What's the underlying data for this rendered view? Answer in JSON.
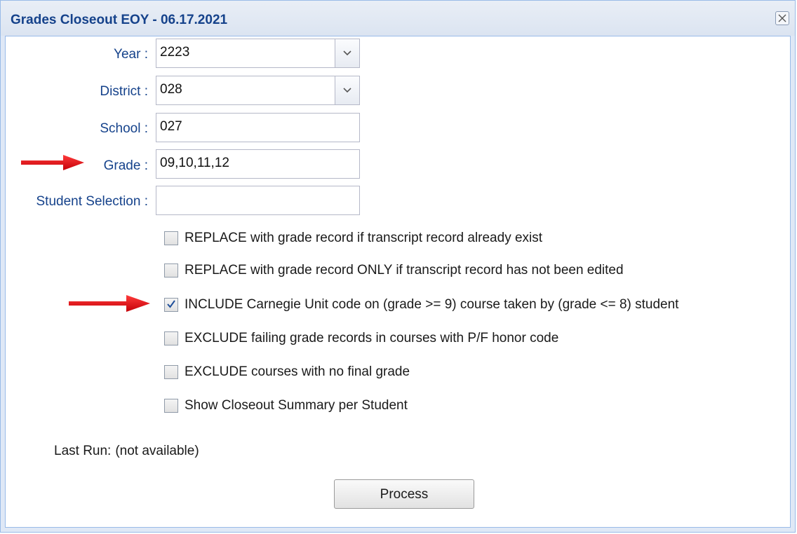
{
  "dialog": {
    "title": "Grades Closeout EOY - 06.17.2021",
    "close_icon": "close-icon"
  },
  "fields": {
    "year": {
      "label": "Year :",
      "value": "2223"
    },
    "district": {
      "label": "District :",
      "value": "028"
    },
    "school": {
      "label": "School :",
      "value": "027"
    },
    "grade": {
      "label": "Grade :",
      "value": "09,10,11,12"
    },
    "student_selection": {
      "label": "Student Selection :",
      "value": ""
    }
  },
  "options": [
    {
      "label": "REPLACE with grade record if transcript record already exist",
      "checked": false
    },
    {
      "label": "REPLACE with grade record ONLY if transcript record has not been edited",
      "checked": false
    },
    {
      "label": "INCLUDE Carnegie Unit code on (grade >= 9) course taken by (grade <= 8) student",
      "checked": true
    },
    {
      "label": "EXCLUDE failing grade records in courses with P/F honor code",
      "checked": false
    },
    {
      "label": "EXCLUDE courses with no final grade",
      "checked": false
    },
    {
      "label": "Show Closeout Summary per Student",
      "checked": false
    }
  ],
  "last_run": {
    "label": "Last Run:",
    "value": "(not available)"
  },
  "process_button": {
    "label": "Process"
  },
  "annotations": {
    "arrow_color": "#e8121a",
    "accent_color": "#15428b"
  }
}
